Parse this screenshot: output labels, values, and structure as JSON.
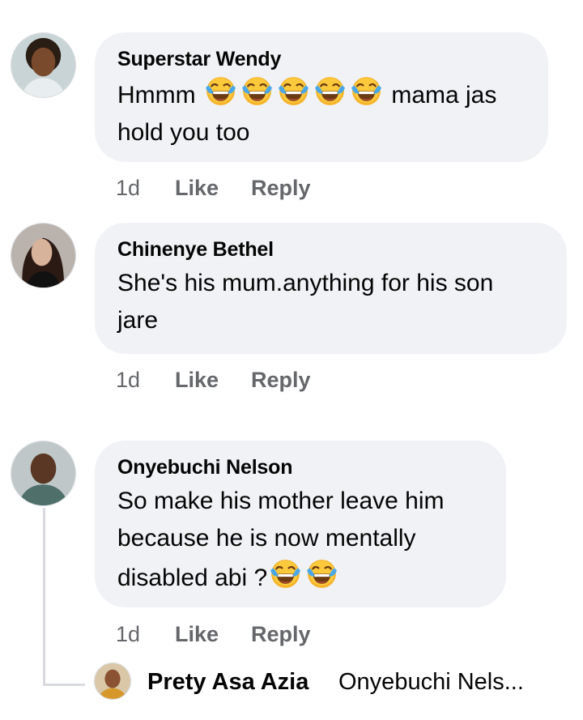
{
  "comments": [
    {
      "author": "Superstar Wendy",
      "text_before": "Hmmm",
      "emoji_count": 5,
      "text_after": "mama jas",
      "text_line2": "hold you too",
      "time": "1d",
      "like": "Like",
      "reply": "Reply"
    },
    {
      "author": "Chinenye Bethel",
      "text_line1": "She's his mum.anything for his son",
      "text_line2": "jare",
      "time": "1d",
      "like": "Like",
      "reply": "Reply"
    },
    {
      "author": "Onyebuchi Nelson",
      "text_line1": "So make his mother leave him",
      "text_line2": "because he is now mentally",
      "text_line3": "disabled abi ?",
      "emoji_count": 2,
      "time": "1d",
      "like": "Like",
      "reply": "Reply"
    }
  ],
  "reply_preview": {
    "author": "Prety Asa Azia",
    "text": "Onyebuchi Nels..."
  },
  "emoji_icon": "face-with-tears-of-joy-icon",
  "colors": {
    "bubble": "#f0f2f5",
    "secondary_text": "#65676b",
    "emoji_face": "#f4a51c"
  }
}
